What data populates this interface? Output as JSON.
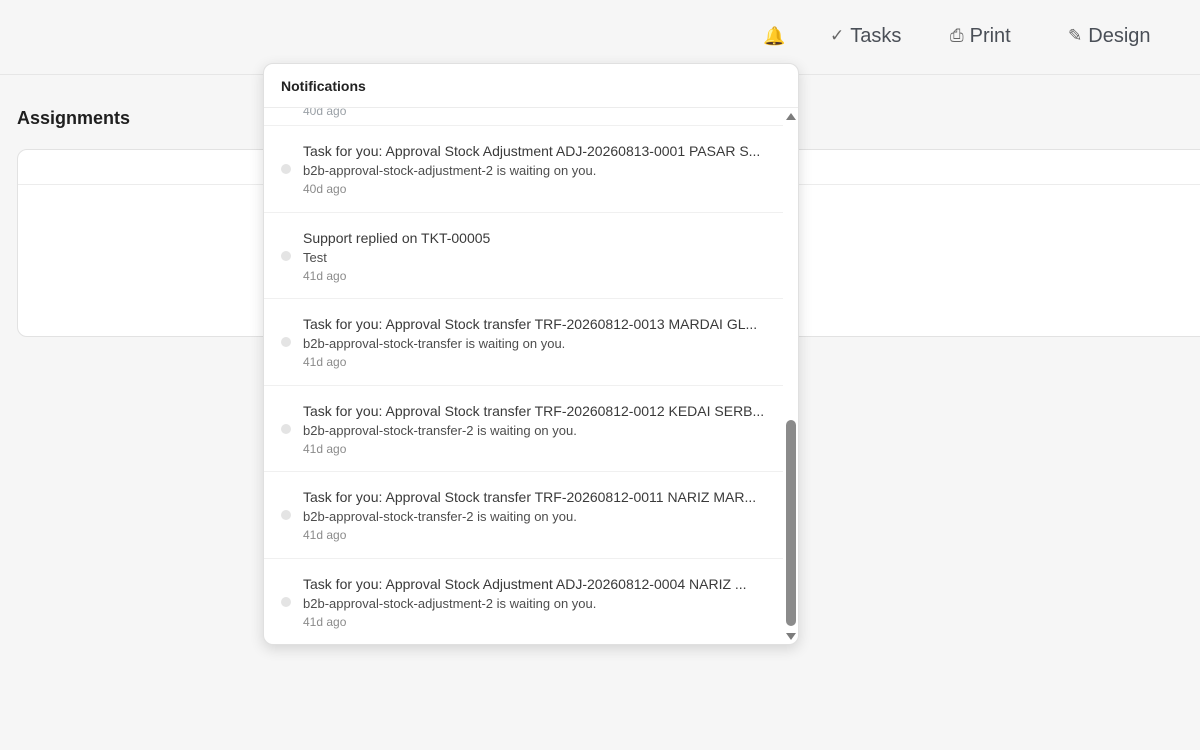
{
  "header": {
    "bell_icon": "🔔",
    "tasks": {
      "icon": "✓",
      "label": "Tasks"
    },
    "print": {
      "icon": "⎙",
      "label": "Print"
    },
    "design": {
      "icon": "✎",
      "label": "Design"
    }
  },
  "main": {
    "section_title": "Assignments"
  },
  "notifications": {
    "title": "Notifications",
    "cut_off_time": "40d ago",
    "items": [
      {
        "title": "Task for you: Approval Stock Adjustment ADJ-20260813-0001 PASAR S...",
        "subtitle": "b2b-approval-stock-adjustment-2 is waiting on you.",
        "time": "40d ago"
      },
      {
        "title": "Support replied on TKT-00005",
        "subtitle": "Test",
        "time": "41d ago"
      },
      {
        "title": "Task for you: Approval Stock transfer TRF-20260812-0013 MARDAI GL...",
        "subtitle": "b2b-approval-stock-transfer is waiting on you.",
        "time": "41d ago"
      },
      {
        "title": "Task for you: Approval Stock transfer TRF-20260812-0012 KEDAI SERB...",
        "subtitle": "b2b-approval-stock-transfer-2 is waiting on you.",
        "time": "41d ago"
      },
      {
        "title": "Task for you: Approval Stock transfer TRF-20260812-0011 NARIZ MAR...",
        "subtitle": "b2b-approval-stock-transfer-2 is waiting on you.",
        "time": "41d ago"
      },
      {
        "title": "Task for you: Approval Stock Adjustment ADJ-20260812-0004 NARIZ ...",
        "subtitle": "b2b-approval-stock-adjustment-2 is waiting on you.",
        "time": "41d ago"
      }
    ]
  }
}
